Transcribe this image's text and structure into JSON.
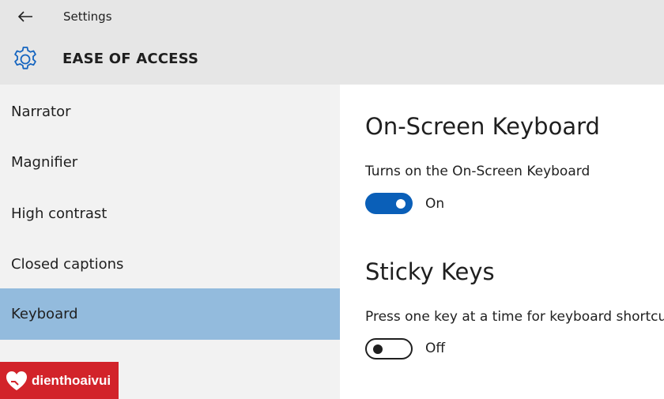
{
  "window": {
    "title": "Settings"
  },
  "header": {
    "section": "EASE OF ACCESS",
    "icon": "gear-icon"
  },
  "sidebar": {
    "items": [
      {
        "label": "Narrator"
      },
      {
        "label": "Magnifier"
      },
      {
        "label": "High contrast"
      },
      {
        "label": "Closed captions"
      },
      {
        "label": "Keyboard",
        "selected": true
      }
    ]
  },
  "main": {
    "onscreen_keyboard": {
      "title": "On-Screen Keyboard",
      "description": "Turns on the On-Screen Keyboard",
      "state": "On"
    },
    "sticky_keys": {
      "title": "Sticky Keys",
      "description": "Press one key at a time for keyboard shortcuts",
      "state": "Off"
    }
  },
  "watermark": {
    "text": "dienthoaivui"
  },
  "colors": {
    "accent": "#0a5fb8",
    "selected_nav": "#93bbdd",
    "watermark_bg": "#d2232a"
  }
}
